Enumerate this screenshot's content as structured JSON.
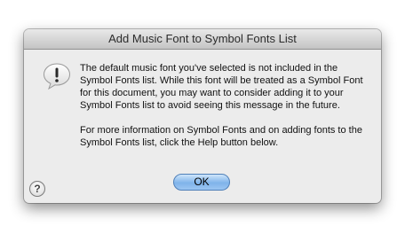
{
  "dialog": {
    "title": "Add Music Font to Symbol Fonts List",
    "icon": "alert-speech-bubble-icon",
    "paragraph1": "The default music font you've selected is not included in the Symbol Fonts list. While this font will be treated as a Symbol Font for this document, you may want to consider adding it to your Symbol Fonts list to avoid seeing this message in the future.",
    "paragraph2": "For more information on Symbol Fonts and on adding fonts to the Symbol Fonts list, click the Help button below.",
    "help_label": "?",
    "ok_label": "OK"
  }
}
